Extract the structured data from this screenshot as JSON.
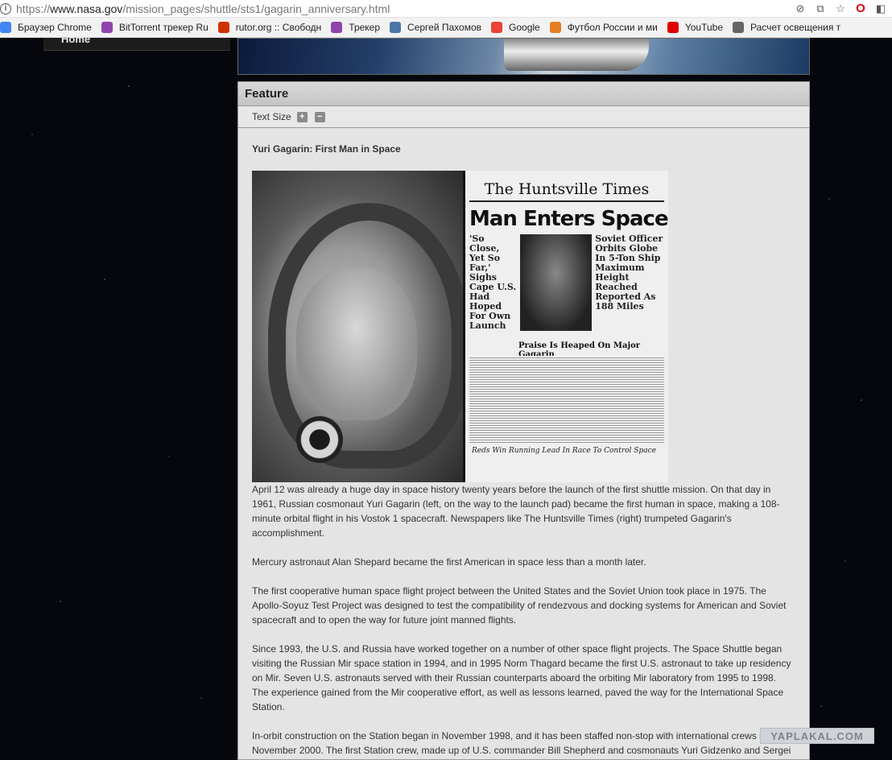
{
  "browser": {
    "url_prefix": "https://",
    "url_host": "www.nasa.gov",
    "url_path": "/mission_pages/shuttle/sts1/gagarin_anniversary.html",
    "icons": [
      "info-icon",
      "blocked-popup-icon",
      "translate-icon",
      "star-icon",
      "opera-icon",
      "extension-icon"
    ]
  },
  "bookmarks": [
    {
      "label": "Браузер Chrome",
      "icon": "chrome-icon",
      "color": "#4285f4"
    },
    {
      "label": "BitTorrent трекер Ru",
      "icon": "tracker-icon",
      "color": "#8e44ad"
    },
    {
      "label": "rutor.org :: Свободн",
      "icon": "rutor-icon",
      "color": "#cc3300"
    },
    {
      "label": "Трекер",
      "icon": "tracker-icon",
      "color": "#8e44ad"
    },
    {
      "label": "Сергей Пахомов",
      "icon": "vk-icon",
      "color": "#4a76a8"
    },
    {
      "label": "Google",
      "icon": "google-icon",
      "color": "#ea4335"
    },
    {
      "label": "Футбол России и ми",
      "icon": "football-icon",
      "color": "#e67e22"
    },
    {
      "label": "YouTube",
      "icon": "youtube-icon",
      "color": "#e00000"
    },
    {
      "label": "Расчет освещения т",
      "icon": "lamp-icon",
      "color": "#666666"
    }
  ],
  "nav": {
    "home_label": "Home"
  },
  "feature": {
    "heading": "Feature",
    "text_size_label": "Text Size",
    "increase_symbol": "+",
    "decrease_symbol": "−"
  },
  "article": {
    "title": "Yuri Gagarin: First Man in Space",
    "newspaper": {
      "masthead": "The Huntsville Times",
      "headline": "Man Enters Space",
      "left_col": "'So Close, Yet So Far,' Sighs Cape U.S. Had Hoped For Own Launch",
      "right_col": "Soviet Officer Orbits Globe In 5-Ton Ship Maximum Height Reached Reported As 188 Miles",
      "sub": "Praise Is Heaped On Major Gagarin",
      "footer": "Reds Win Running Lead In Race To Control Space"
    },
    "paragraphs": [
      "April 12 was already a huge day in space history twenty years before the launch of the first shuttle mission. On that day in 1961, Russian cosmonaut Yuri Gagarin (left, on the way to the launch pad) became the first human in space, making a 108-minute orbital flight in his Vostok 1 spacecraft. Newspapers like The Huntsville Times (right) trumpeted Gagarin's accomplishment.",
      "Mercury astronaut Alan Shepard became the first American in space less than a month later.",
      "The first cooperative human space flight project between the United States and the Soviet Union took place in 1975. The Apollo-Soyuz Test Project was designed to test the compatibility of rendezvous and docking systems for American and Soviet spacecraft and to open the way for future joint manned flights.",
      "Since 1993, the U.S. and Russia have worked together on a number of other space flight projects. The Space Shuttle began visiting the Russian Mir space station in 1994, and in 1995 Norm Thagard became the first U.S. astronaut to take up residency on Mir. Seven U.S. astronauts served with their Russian counterparts aboard the orbiting Mir laboratory from 1995 to 1998. The experience gained from the Mir cooperative effort, as well as lessons learned, paved the way for the International Space Station.",
      "In-orbit construction on the Station began in November 1998, and it has been staffed non-stop with international crews since November 2000. The first Station crew, made up of U.S. commander Bill Shepherd and cosmonauts Yuri Gidzenko and Sergei"
    ]
  },
  "watermark": "YAPLAKAL.COM"
}
